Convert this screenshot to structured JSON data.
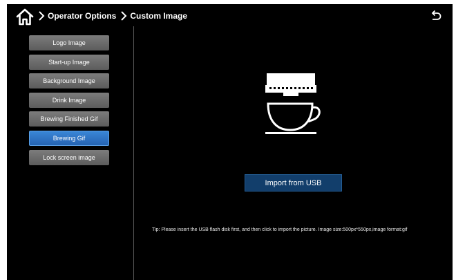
{
  "header": {
    "home_icon": "home-icon",
    "breadcrumb": [
      "Operator Options",
      "Custom Image"
    ],
    "back_icon": "back-arrow-icon"
  },
  "sidebar": {
    "items": [
      {
        "label": "Logo Image",
        "active": false
      },
      {
        "label": "Start-up Image",
        "active": false
      },
      {
        "label": "Background Image",
        "active": false
      },
      {
        "label": "Drink Image",
        "active": false
      },
      {
        "label": "Brewing Finished Gif",
        "active": false
      },
      {
        "label": "Brewing Gif",
        "active": true
      },
      {
        "label": "Lock screen image",
        "active": false
      }
    ]
  },
  "main": {
    "preview_icon": "coffee-machine-cup-icon",
    "import_label": "Import from USB",
    "tip": "Tip: Please insert the USB flash disk first, and then click to import the picture. Image size:500px*550px,image format:gif"
  },
  "colors": {
    "background": "#000000",
    "menu_item": "#6b6b6b",
    "menu_item_active": "#2f73c4",
    "import_button": "#123e6b"
  }
}
